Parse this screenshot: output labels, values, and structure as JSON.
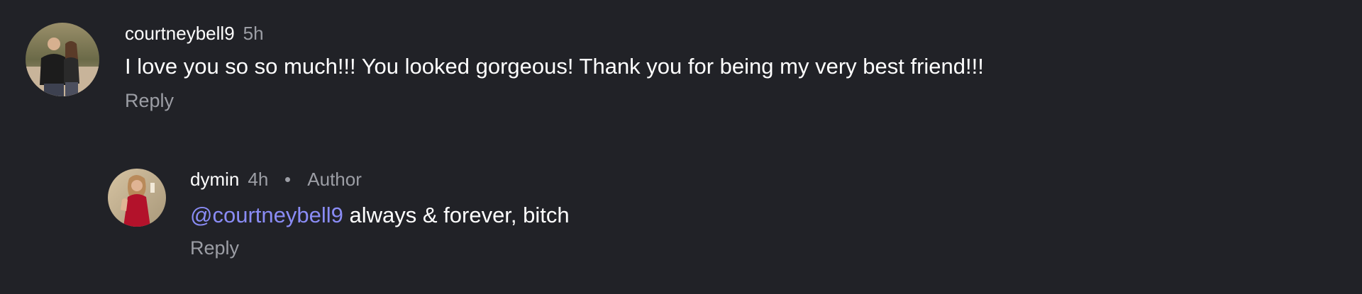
{
  "comments": [
    {
      "username": "courtneybell9",
      "time": "5h",
      "text": "I love you so so much!!! You looked gorgeous! Thank you for being my very best friend!!!",
      "reply_label": "Reply",
      "avatar_icon": "user-avatar-couple"
    }
  ],
  "replies": [
    {
      "username": "dymin",
      "time": "4h",
      "author_badge": "Author",
      "mention": "@courtneybell9",
      "text": " always & forever, bitch",
      "reply_label": "Reply",
      "avatar_icon": "user-avatar-red-dress"
    }
  ],
  "colors": {
    "background": "#212227",
    "text_primary": "#ffffff",
    "text_secondary": "#9c9ea5",
    "mention": "#8a8cf5"
  }
}
